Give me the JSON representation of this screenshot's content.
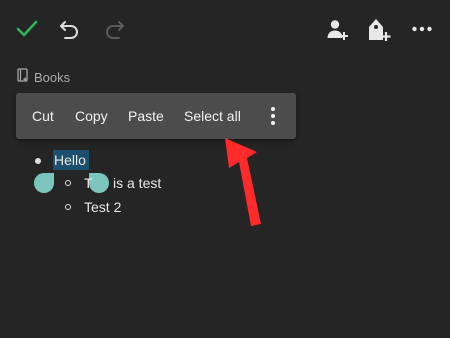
{
  "toolbar": {
    "confirm_icon": "checkmark-icon",
    "undo_icon": "undo-icon",
    "redo_icon": "redo-icon",
    "share_icon": "add-person-icon",
    "tag_icon": "add-tag-icon",
    "more_icon": "more-horizontal-icon"
  },
  "breadcrumb": {
    "icon": "notebook-icon",
    "label": "Books"
  },
  "context_menu": {
    "items": [
      {
        "label": "Cut"
      },
      {
        "label": "Copy"
      },
      {
        "label": "Paste"
      },
      {
        "label": "Select all"
      }
    ],
    "more_icon": "more-vertical-icon"
  },
  "document": {
    "lines": [
      {
        "level": 1,
        "text": "Hello",
        "selected": true
      },
      {
        "level": 2,
        "text_before_handle": "T",
        "text_after_handle": "is a test"
      },
      {
        "level": 2,
        "text": "Test 2"
      }
    ]
  },
  "colors": {
    "background": "#252525",
    "menu_background": "#4c4c4c",
    "selection": "#1d4f6e",
    "handle": "#7cc5bc",
    "check": "#2fb35a",
    "annotation_arrow": "#ff2a2a"
  }
}
